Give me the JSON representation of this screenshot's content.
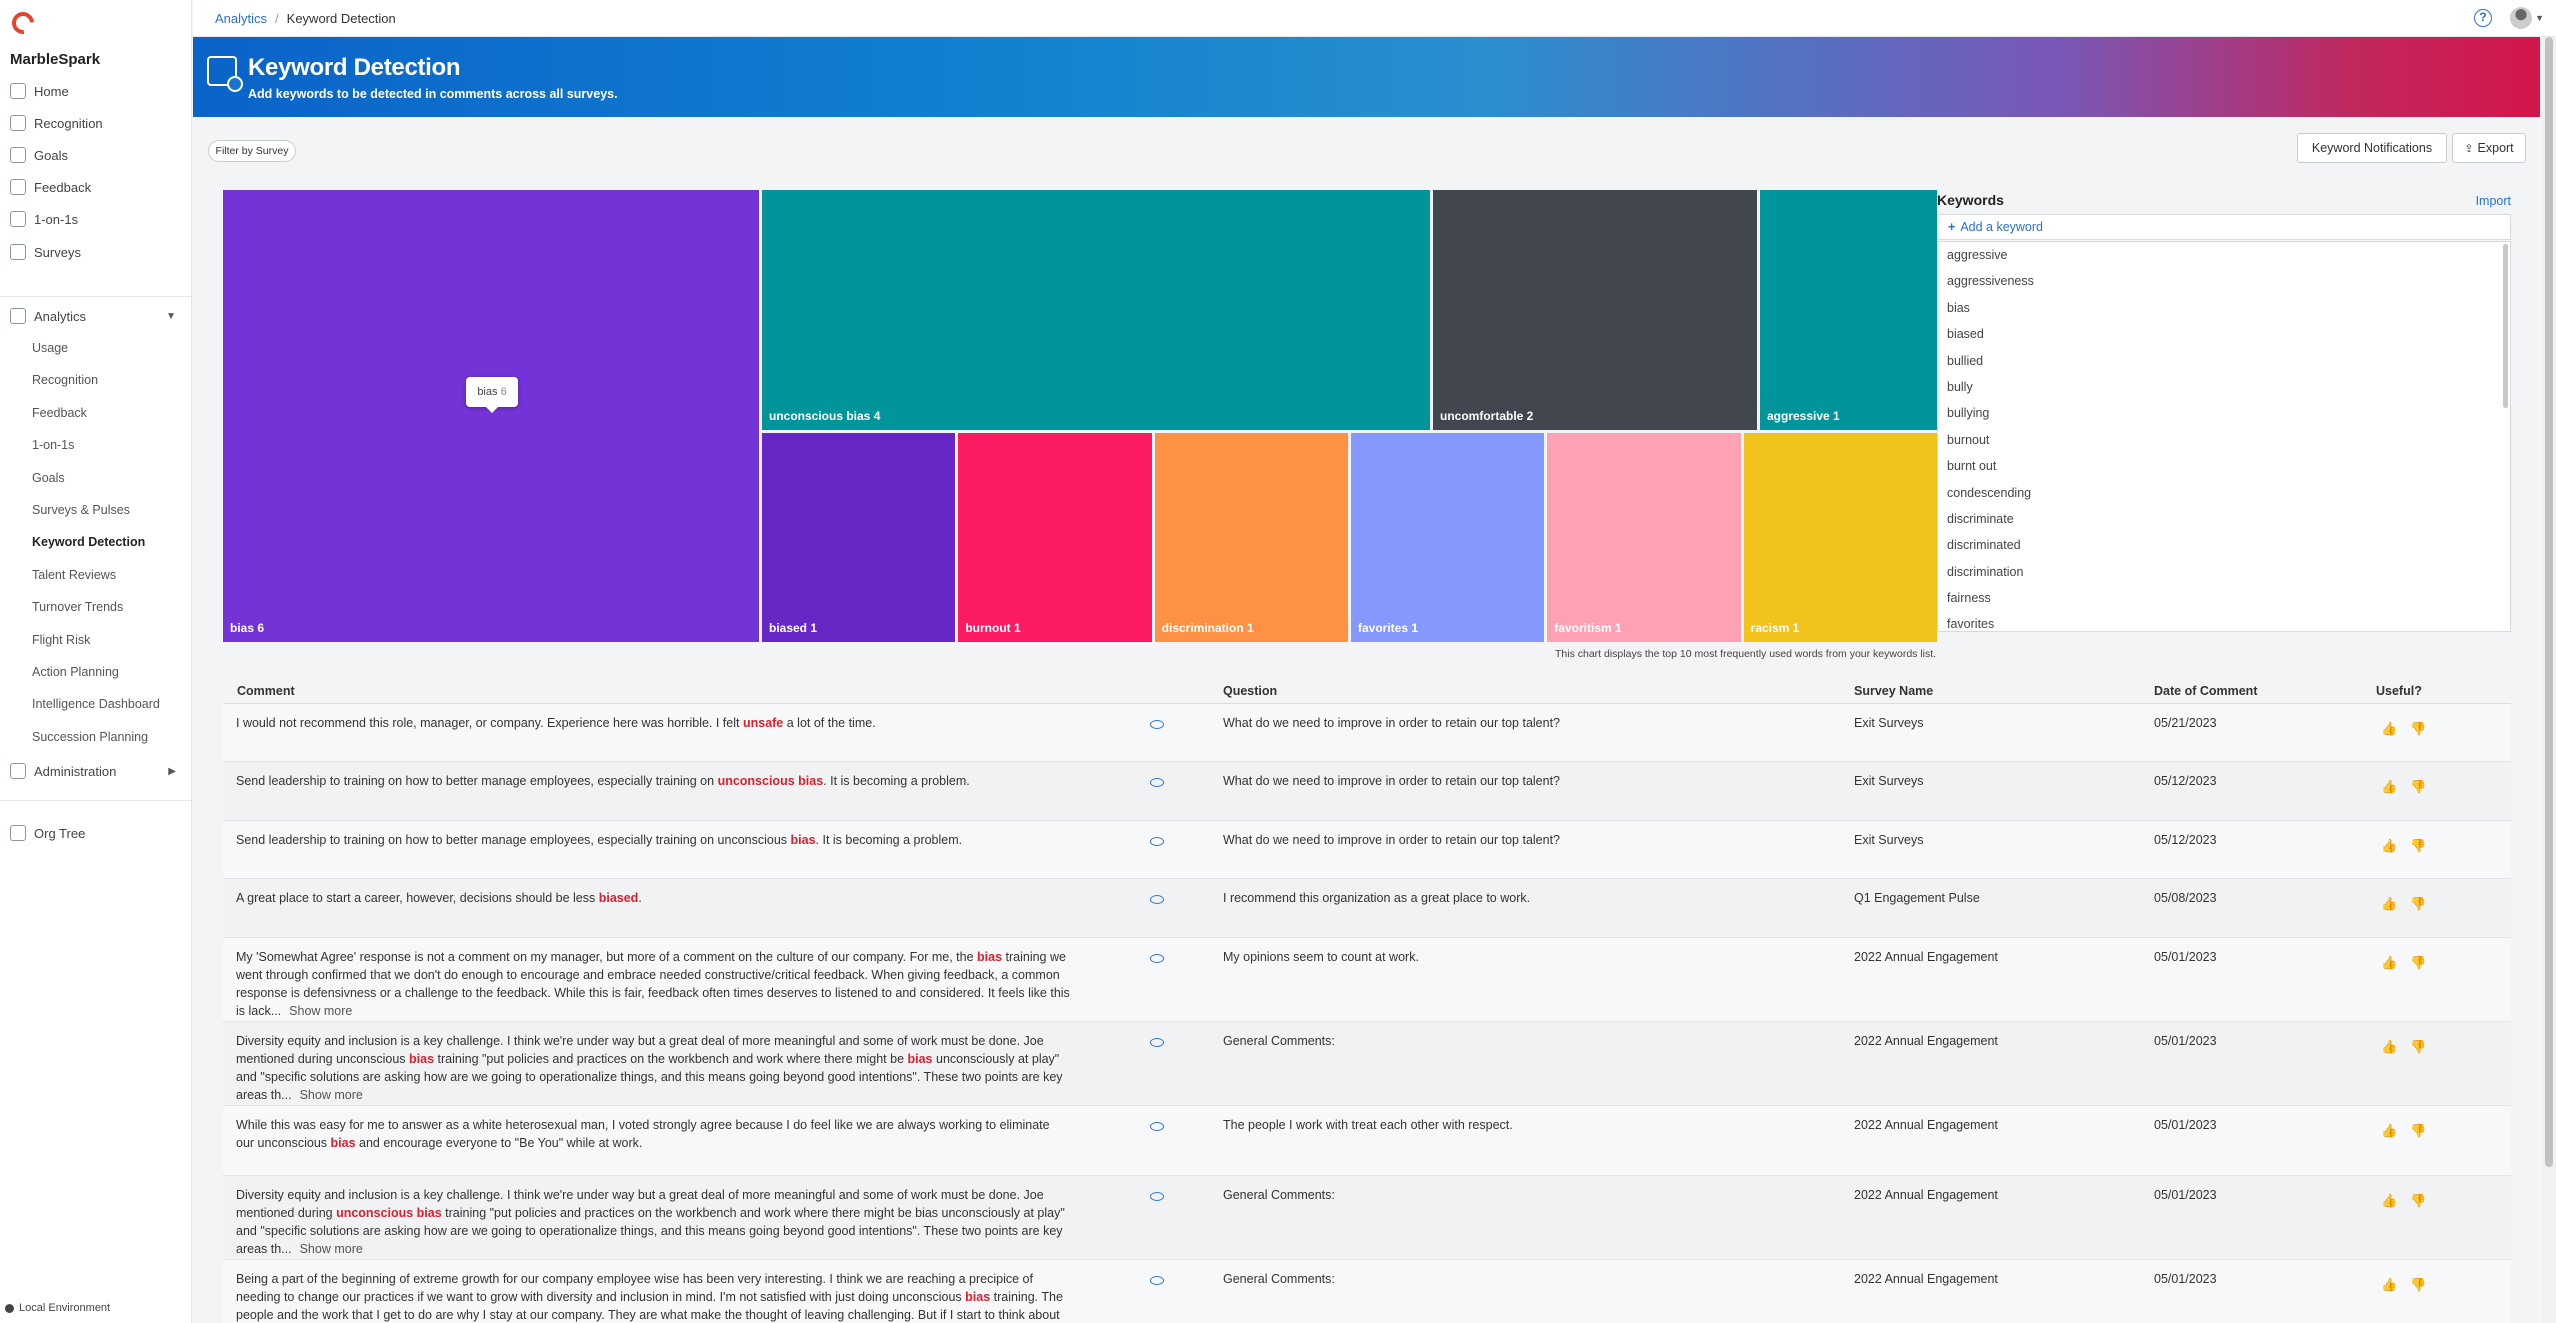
{
  "app": {
    "brand": "MarbleSpark",
    "environment": "Local Environment"
  },
  "sidebar": {
    "primary": [
      {
        "label": "Home",
        "icon": "home-icon"
      },
      {
        "label": "Recognition",
        "icon": "recognition-icon"
      },
      {
        "label": "Goals",
        "icon": "goals-icon"
      },
      {
        "label": "Feedback",
        "icon": "feedback-icon"
      },
      {
        "label": "1-on-1s",
        "icon": "one-on-one-icon"
      },
      {
        "label": "Surveys",
        "icon": "surveys-icon"
      }
    ],
    "analytics": {
      "label": "Analytics",
      "icon": "analytics-icon"
    },
    "analytics_items": [
      "Usage",
      "Recognition",
      "Feedback",
      "1-on-1s",
      "Goals",
      "Surveys & Pulses",
      "Keyword Detection",
      "Talent Reviews",
      "Turnover Trends",
      "Flight Risk",
      "Action Planning",
      "Intelligence Dashboard",
      "Succession Planning"
    ],
    "administration": {
      "label": "Administration",
      "icon": "administration-icon"
    },
    "org_tree": {
      "label": "Org Tree",
      "icon": "org-tree-icon"
    },
    "active_item": "Keyword Detection"
  },
  "topbar": {
    "breadcrumb_root": "Analytics",
    "breadcrumb_current": "Keyword Detection",
    "help_glyph": "?"
  },
  "banner": {
    "title": "Keyword Detection",
    "subtitle": "Add keywords to be detected in comments across all surveys."
  },
  "controls": {
    "filter_label": "Filter by Survey",
    "notifications_label": "Keyword Notifications",
    "export_label": "Export"
  },
  "chart_data": {
    "type": "treemap",
    "items": [
      {
        "keyword": "bias",
        "count": 6,
        "label": "bias 6",
        "color": "#7433d6"
      },
      {
        "keyword": "unconscious bias",
        "count": 4,
        "label": "unconscious bias 4",
        "color": "#00959b"
      },
      {
        "keyword": "uncomfortable",
        "count": 2,
        "label": "uncomfortable 2",
        "color": "#42464f"
      },
      {
        "keyword": "aggressive",
        "count": 1,
        "label": "aggressive 1",
        "color": "#00959b"
      },
      {
        "keyword": "biased",
        "count": 1,
        "label": "biased 1",
        "color": "#6627c6"
      },
      {
        "keyword": "burnout",
        "count": 1,
        "label": "burnout 1",
        "color": "#fc1a63"
      },
      {
        "keyword": "discrimination",
        "count": 1,
        "label": "discrimination 1",
        "color": "#fd9244"
      },
      {
        "keyword": "favorites",
        "count": 1,
        "label": "favorites 1",
        "color": "#8598fd"
      },
      {
        "keyword": "favoritism",
        "count": 1,
        "label": "favoritism 1",
        "color": "#fea1b2"
      },
      {
        "keyword": "racism",
        "count": 1,
        "label": "racism 1",
        "color": "#f2c31d"
      }
    ],
    "tooltip": {
      "name": "bias",
      "value": "6"
    },
    "note": "This chart displays the top 10 most frequently used words from your keywords list."
  },
  "keywords": {
    "title": "Keywords",
    "import_label": "Import",
    "add_label": "Add a keyword",
    "items": [
      "aggressive",
      "aggressiveness",
      "bias",
      "biased",
      "bullied",
      "bully",
      "bullying",
      "burnout",
      "burnt out",
      "condescending",
      "discriminate",
      "discriminated",
      "discrimination",
      "fairness",
      "favorites"
    ]
  },
  "table": {
    "headers": {
      "comment": "Comment",
      "question": "Question",
      "survey": "Survey Name",
      "date": "Date of Comment",
      "useful": "Useful?"
    },
    "show_more": "Show more",
    "rows": [
      {
        "comment": [
          [
            "I would not recommend this role, manager, or company. Experience here was horrible. I felt ",
            false
          ],
          [
            "unsafe",
            true
          ],
          [
            " a lot of the time.",
            false
          ]
        ],
        "more": false,
        "question": "What do we need to improve in order to retain our top talent?",
        "survey": "Exit Surveys",
        "date": "05/21/2023"
      },
      {
        "comment": [
          [
            "Send leadership to training on how to better manage employees, especially training on ",
            false
          ],
          [
            "unconscious bias",
            true
          ],
          [
            ". It is becoming a problem.",
            false
          ]
        ],
        "more": false,
        "question": "What do we need to improve in order to retain our top talent?",
        "survey": "Exit Surveys",
        "date": "05/12/2023"
      },
      {
        "comment": [
          [
            "Send leadership to training on how to better manage employees, especially training on unconscious ",
            false
          ],
          [
            "bias",
            true
          ],
          [
            ". It is becoming a problem.",
            false
          ]
        ],
        "more": false,
        "question": "What do we need to improve in order to retain our top talent?",
        "survey": "Exit Surveys",
        "date": "05/12/2023"
      },
      {
        "comment": [
          [
            "A great place to start a career, however, decisions should be less ",
            false
          ],
          [
            "biased",
            true
          ],
          [
            ".",
            false
          ]
        ],
        "more": false,
        "question": "I recommend this organization as a great place to work.",
        "survey": "Q1 Engagement Pulse",
        "date": "05/08/2023"
      },
      {
        "comment": [
          [
            "My 'Somewhat Agree' response is not a comment on my manager, but more of a comment on the culture of our company. For me, the ",
            false
          ],
          [
            "bias",
            true
          ],
          [
            " training we went through confirmed that we don't do enough to encourage and embrace needed constructive/critical feedback. When giving feedback, a common response is defensivness or a challenge to the feedback. While this is fair, feedback often times deserves to listened to and considered. It feels like this is lack...",
            false
          ]
        ],
        "more": true,
        "question": "My opinions seem to count at work.",
        "survey": "2022 Annual Engagement",
        "date": "05/01/2023"
      },
      {
        "comment": [
          [
            "Diversity equity and inclusion is a key challenge. I think we're under way but a great deal of more meaningful and some of work must be done. Joe mentioned during unconscious ",
            false
          ],
          [
            "bias",
            true
          ],
          [
            " training \"put policies and practices on the workbench and work where there might be ",
            false
          ],
          [
            "bias",
            true
          ],
          [
            " unconsciously at play\" and \"specific solutions are asking how are we going to operationalize things, and this means going beyond good intentions\". These two points are key areas th...",
            false
          ]
        ],
        "more": true,
        "question": "General Comments:",
        "survey": "2022 Annual Engagement",
        "date": "05/01/2023"
      },
      {
        "comment": [
          [
            "While this was easy for me to answer as a white heterosexual man, I voted strongly agree because I do feel like we are always working to eliminate our unconscious ",
            false
          ],
          [
            "bias",
            true
          ],
          [
            " and encourage everyone to \"Be You\" while at work.",
            false
          ]
        ],
        "more": false,
        "question": "The people I work with treat each other with respect.",
        "survey": "2022 Annual Engagement",
        "date": "05/01/2023"
      },
      {
        "comment": [
          [
            "Diversity equity and inclusion is a key challenge. I think we're under way but a great deal of more meaningful and some of work must be done. Joe mentioned during ",
            false
          ],
          [
            "unconscious bias",
            true
          ],
          [
            " training \"put policies and practices on the workbench and work where there might be bias unconsciously at play\" and \"specific solutions are asking how are we going to operationalize things, and this means going beyond good intentions\". These two points are key areas th...",
            false
          ]
        ],
        "more": true,
        "question": "General Comments:",
        "survey": "2022 Annual Engagement",
        "date": "05/01/2023"
      },
      {
        "comment": [
          [
            "Being a part of the beginning of extreme growth for our company employee wise has been very interesting. I think we are reaching a precipice of needing to change our practices if we want to grow with diversity and inclusion in mind. I'm not satisfied with just doing unconscious ",
            false
          ],
          [
            "bias",
            true
          ],
          [
            " training. The people and the work that I get to do are why I stay at our company. They are what make the thought of leaving challenging. But if I start to think about some of the othe...",
            false
          ]
        ],
        "more": true,
        "question": "General Comments:",
        "survey": "2022 Annual Engagement",
        "date": "05/01/2023"
      }
    ]
  }
}
